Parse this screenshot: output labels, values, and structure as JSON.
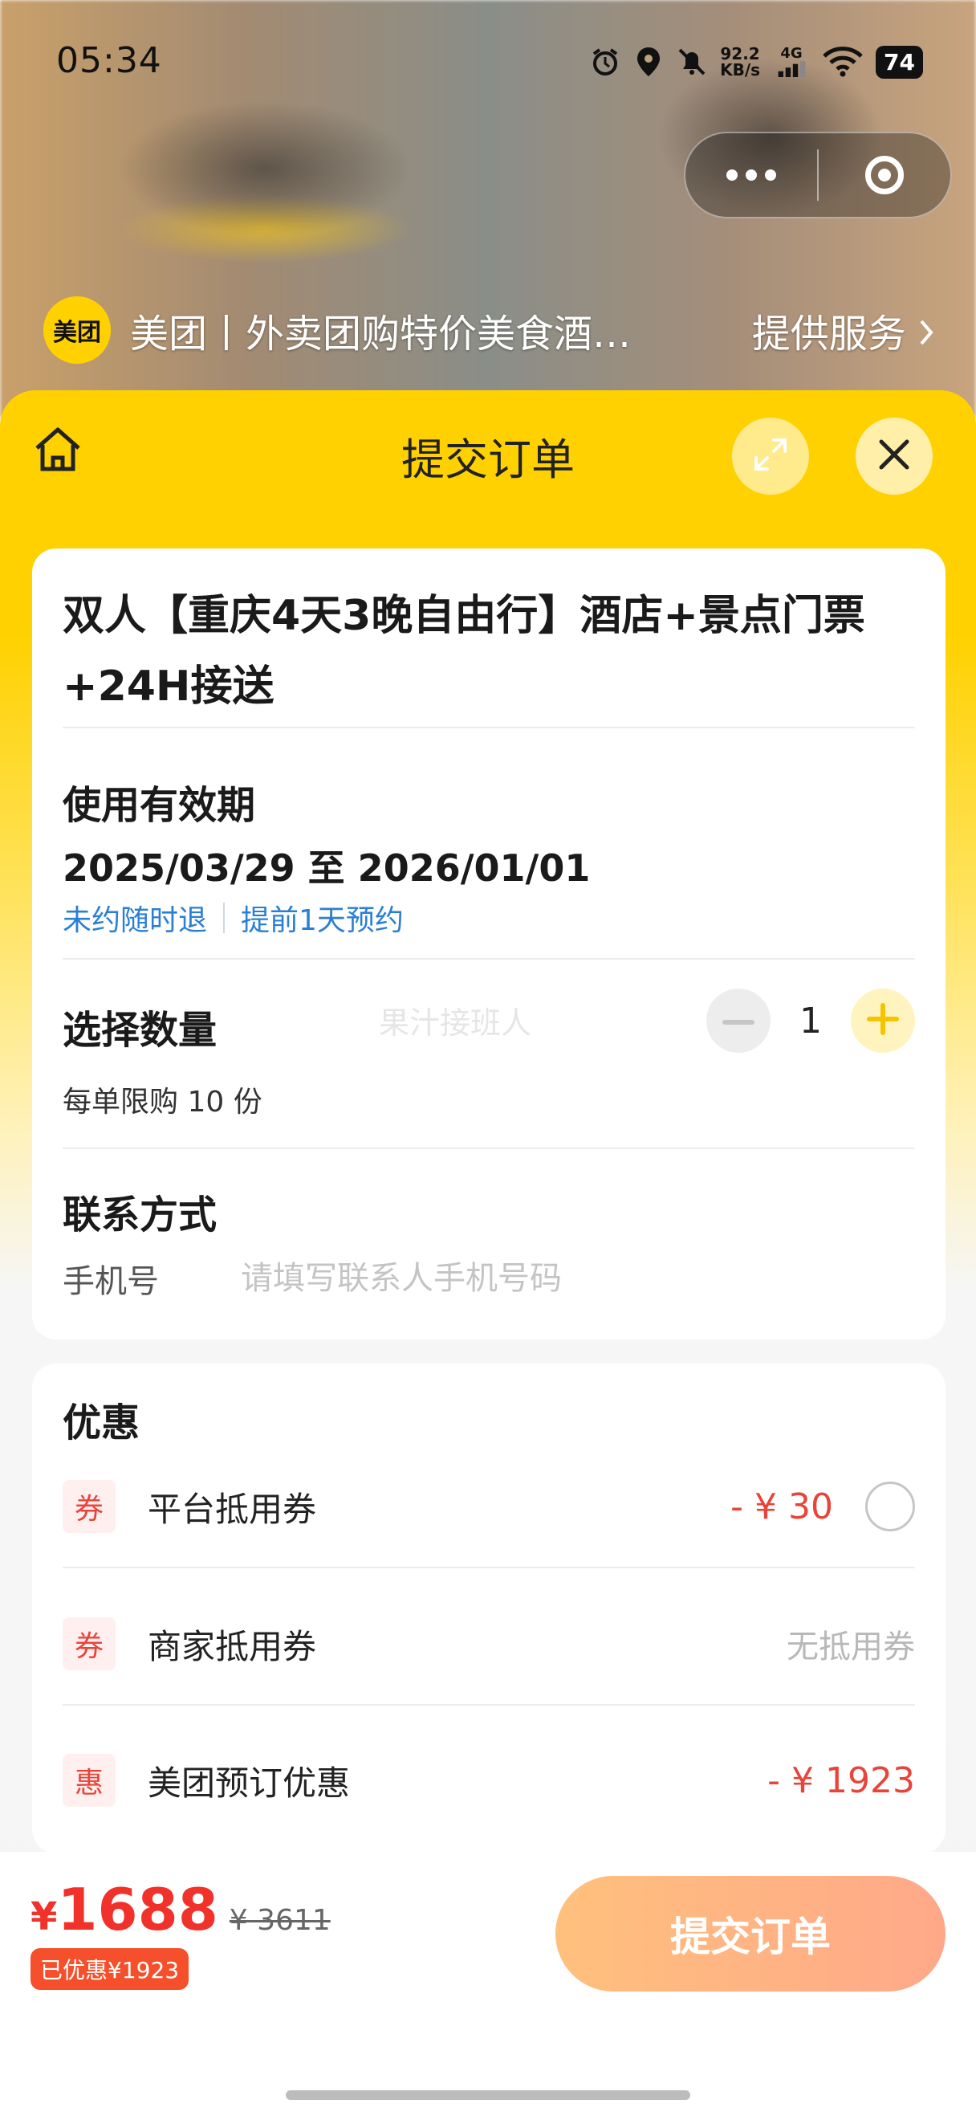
{
  "status_bar": {
    "time": "05:34",
    "net_speed_value": "92.2",
    "net_speed_unit": "KB/s",
    "network": "4G",
    "battery": "74"
  },
  "mini_program": {
    "logo_text": "美团",
    "title": "美团丨外卖团购特价美食酒…",
    "service": "提供服务"
  },
  "sheet": {
    "title": "提交订单"
  },
  "product": {
    "title": "双人【重庆4天3晚自由行】酒店+景点门票+24H接送"
  },
  "validity": {
    "label": "使用有效期",
    "dates": "2025/03/29 至 2026/01/01",
    "policy_refund": "未约随时退",
    "policy_booking": "提前1天预约"
  },
  "quantity": {
    "label": "选择数量",
    "value": "1",
    "limit": "每单限购 10 份",
    "watermark": "果汁接班人"
  },
  "contact": {
    "label": "联系方式",
    "phone_label": "手机号",
    "phone_placeholder": "请填写联系人手机号码",
    "phone_value": ""
  },
  "discounts": {
    "label": "优惠",
    "items": [
      {
        "tag": "券",
        "label": "平台抵用券",
        "value": "- ¥ 30",
        "selected": false
      },
      {
        "tag": "券",
        "label": "商家抵用券",
        "value": "无抵用券"
      },
      {
        "tag": "惠",
        "label": "美团预订优惠",
        "value": "- ¥ 1923"
      }
    ]
  },
  "footer": {
    "price_symbol": "¥",
    "price": "1688",
    "original_price": "¥ 3611",
    "saved": "已优惠¥1923",
    "submit_label": "提交订单"
  },
  "colors": {
    "brand_yellow": "#ffd100",
    "price_red": "#f0322a",
    "link_blue": "#2a7fd4",
    "submit_gradient_start": "#ffc07d",
    "submit_gradient_end": "#ffa889"
  }
}
